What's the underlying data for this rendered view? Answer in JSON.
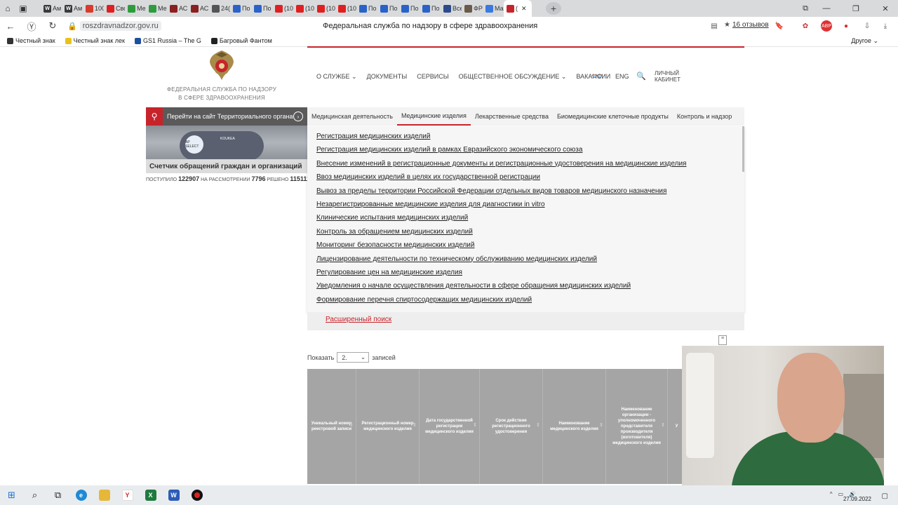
{
  "browser": {
    "tabs": [
      {
        "label": "Ам",
        "color": "#3a3a3a",
        "glyph": "W"
      },
      {
        "label": "Ам",
        "color": "#3a3a3a",
        "glyph": "W"
      },
      {
        "label": "100",
        "color": "#d93a2b",
        "glyph": ""
      },
      {
        "label": "Сво",
        "color": "#e02020",
        "glyph": ""
      },
      {
        "label": "Ме",
        "color": "#2d9c3c",
        "glyph": ""
      },
      {
        "label": "Ме",
        "color": "#2d9c3c",
        "glyph": ""
      },
      {
        "label": "АС",
        "color": "#8a2020",
        "glyph": ""
      },
      {
        "label": "АС",
        "color": "#8a2020",
        "glyph": ""
      },
      {
        "label": "24(",
        "color": "#555555",
        "glyph": ""
      },
      {
        "label": "По",
        "color": "#2a62c9",
        "glyph": ""
      },
      {
        "label": "По",
        "color": "#2a62c9",
        "glyph": ""
      },
      {
        "label": "(10",
        "color": "#e02020",
        "glyph": ""
      },
      {
        "label": "(10",
        "color": "#e02020",
        "glyph": ""
      },
      {
        "label": "(10",
        "color": "#e02020",
        "glyph": ""
      },
      {
        "label": "(10",
        "color": "#e02020",
        "glyph": ""
      },
      {
        "label": "По",
        "color": "#2a62c9",
        "glyph": ""
      },
      {
        "label": "По",
        "color": "#2a62c9",
        "glyph": ""
      },
      {
        "label": "По",
        "color": "#2a62c9",
        "glyph": ""
      },
      {
        "label": "По",
        "color": "#2a62c9",
        "glyph": ""
      },
      {
        "label": "Все",
        "color": "#2b4b8a",
        "glyph": ""
      },
      {
        "label": "ФР",
        "color": "#6b5a4a",
        "glyph": ""
      },
      {
        "label": "Ма",
        "color": "#3a7ae0",
        "glyph": ""
      }
    ],
    "active_tab": {
      "label": "(",
      "color": "#c7232a"
    },
    "url": "roszdravnadzor.gov.ru",
    "page_title": "Федеральная служба по надзору в сфере здравоохранения",
    "reviews": "16 отзывов",
    "bookmarks": [
      {
        "label": "Честный знак",
        "color": "#333333"
      },
      {
        "label": "Честный знак лек",
        "color": "#e8c21c"
      },
      {
        "label": "GS1 Russia – The G",
        "color": "#1c4fa0"
      },
      {
        "label": "Багровый Фантом",
        "color": "#222222"
      }
    ],
    "other_bookmarks": "Другое"
  },
  "site": {
    "agency_line1": "ФЕДЕРАЛЬНАЯ СЛУЖБА ПО НАДЗОРУ",
    "agency_line2": "В СФЕРЕ ЗДРАВООХРАНЕНИЯ",
    "main_nav": [
      "О СЛУЖБЕ",
      "ДОКУМЕНТЫ",
      "СЕРВИСЫ",
      "ОБЩЕСТВЕННОЕ ОБСУЖДЕНИЕ",
      "ВАКАНСИИ"
    ],
    "lang": "ENG",
    "cabinet_line1": "ЛИЧНЫЙ",
    "cabinet_line2": "КАБИНЕТ",
    "territorial": "Перейти на сайт Территориального органа",
    "sub_nav": [
      "Медицинская деятельность",
      "Медицинские изделия",
      "Лекарственные средства",
      "Биомедицинские клеточные продукты",
      "Контроль и надзор"
    ],
    "sub_nav_active": 1,
    "counter": {
      "title": "Счетчик обращений граждан и организаций",
      "received_label": "ПОСТУПИЛО",
      "received": "122907",
      "review_label": "НА РАССМОТРЕНИИ",
      "review": "7796",
      "solved_label": "РЕШЕНО",
      "solved": "115111"
    },
    "banner": {
      "badge": "AP SELECT",
      "brand": "KOUKEA"
    },
    "dropdown": [
      "Регистрация медицинских изделий",
      "Регистрация медицинских изделий в рамках Евразийского экономического союза",
      "Внесение изменений в регистрационные документы и регистрационные удостоверения на медицинские изделия",
      "Ввоз медицинских изделий в целях их государственной регистрации",
      "Вывоз за пределы территории Российской Федерации отдельных видов товаров медицинского назначения",
      "Незарегистрированные медицинские изделия для диагностики in vitro",
      "Клинические испытания медицинских изделий",
      "Контроль за обращением медицинских изделий",
      "Мониторинг безопасности медицинских изделий",
      "Лицензирование деятельности по техническому обслуживанию медицинских изделий",
      "Регулирование цен на медицинские изделия",
      "Уведомления о начале осуществления деятельности в сфере обращения медицинских изделий",
      "Формирование перечня спиртосодержащих медицинских изделий"
    ],
    "advanced_search": "Расширенный поиск",
    "show_label": "Показать",
    "show_value": "2.",
    "records_label": "записей",
    "table_headers": [
      "Уникальный номер реестровой записи",
      "Регистрационный номер медицинского изделия",
      "Дата государственной регистрации медицинского изделия",
      "Срок действия регистрационного удостоверения",
      "Наименование медицинского изделия",
      "Наименование организации - уполномоченного представителя производителя (изготовителя) медицинского изделия",
      "У"
    ]
  },
  "taskbar": {
    "date": "27.09.2022",
    "apps": [
      {
        "name": "start",
        "color": "#1f6fd1"
      },
      {
        "name": "edge",
        "color": "#1e8ad6"
      },
      {
        "name": "explorer",
        "color": "#e6b83a"
      },
      {
        "name": "yandex",
        "color": "#e02020"
      },
      {
        "name": "excel",
        "color": "#1f7a3e"
      },
      {
        "name": "word",
        "color": "#2b5cb8"
      },
      {
        "name": "recorder",
        "color": "#111111"
      }
    ]
  }
}
